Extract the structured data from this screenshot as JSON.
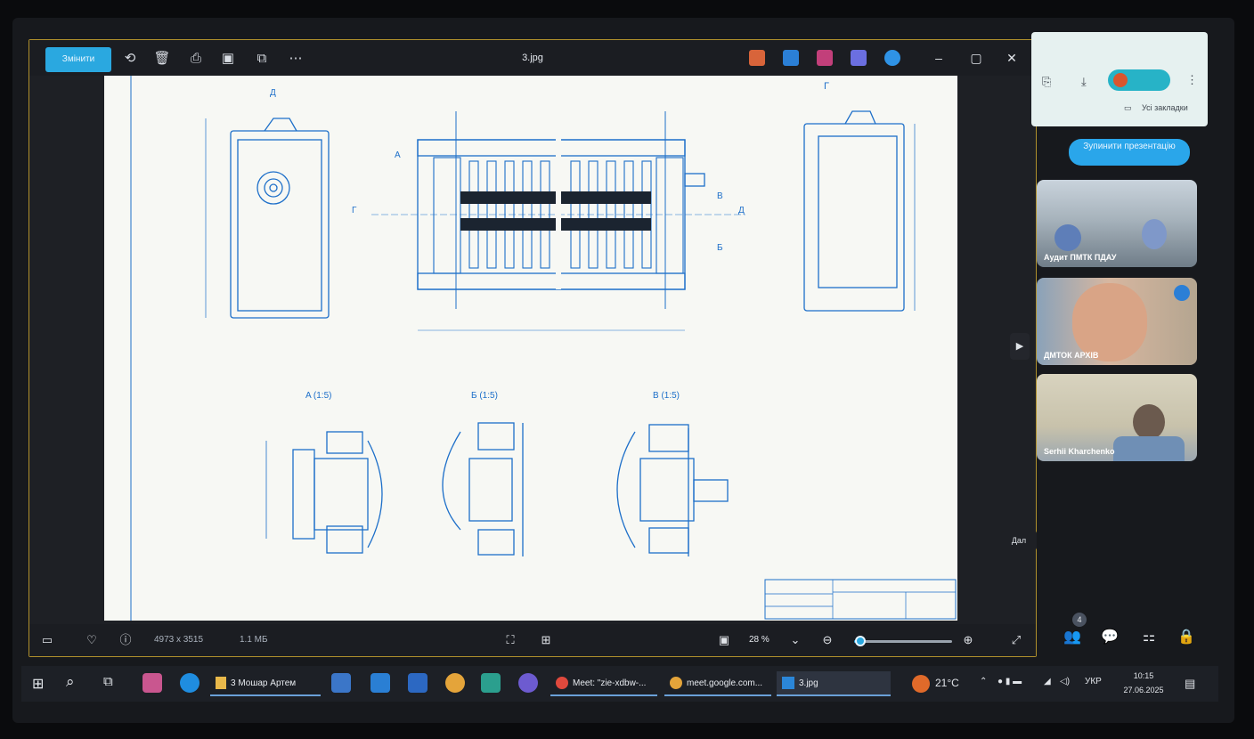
{
  "viewer": {
    "edit_label": "Змінити",
    "title": "3.jpg",
    "image_dimensions": "4973 x 3515",
    "file_size": "1.1 МБ",
    "zoom_level": "28 %",
    "zoom_fraction": 0.06
  },
  "drawing": {
    "view_left_label": "Д",
    "view_right_label": "Г",
    "section_labels": [
      "A (1:5)",
      "Б (1:5)",
      "B (1:5)"
    ],
    "section_markers": [
      "A",
      "B",
      "Б",
      "Г",
      "Д"
    ]
  },
  "meet": {
    "all_bookmarks": "Усі закладки",
    "stop_presenting": "Зупинити презентацію",
    "participants": [
      {
        "name": "Аудит ПМТК ПДАУ"
      },
      {
        "name": "ДМТОК АРХІВ"
      },
      {
        "name": "Serhii Kharchenko"
      }
    ],
    "participant_count": "4",
    "tooltip": "Дал"
  },
  "taskbar": {
    "apps": [
      {
        "label": "3 Мошар Артем"
      },
      {
        "label": "Meet: \"zie-xdbw-..."
      },
      {
        "label": "meet.google.com..."
      },
      {
        "label": "3.jpg"
      }
    ],
    "weather": "21°C",
    "language": "УКР",
    "time": "10:15",
    "date": "27.06.2025"
  },
  "colors": {
    "accent": "#2aa8e0",
    "drawing_line": "#1d6fc9",
    "window_bg": "#1e2025",
    "focus_border": "#b0902c"
  }
}
